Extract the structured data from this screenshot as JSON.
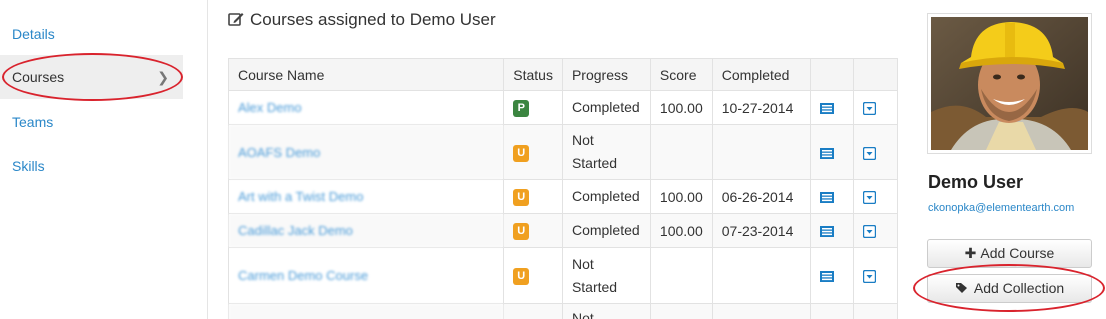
{
  "sidebar": {
    "items": [
      {
        "label": "Details"
      },
      {
        "label": "Courses"
      },
      {
        "label": "Teams"
      },
      {
        "label": "Skills"
      }
    ]
  },
  "main": {
    "title": "Courses assigned to Demo User",
    "columns": [
      "Course Name",
      "Status",
      "Progress",
      "Score",
      "Completed",
      "",
      ""
    ],
    "rows": [
      {
        "name": "Alex Demo",
        "status": "P",
        "progress": "Completed",
        "score": "100.00",
        "completed": "10-27-2014"
      },
      {
        "name": "AOAFS Demo",
        "status": "U",
        "progress": "Not\nStarted",
        "score": "",
        "completed": ""
      },
      {
        "name": "Art with a Twist Demo",
        "status": "U",
        "progress": "Completed",
        "score": "100.00",
        "completed": "06-26-2014"
      },
      {
        "name": "Cadillac Jack Demo",
        "status": "U",
        "progress": "Completed",
        "score": "100.00",
        "completed": "07-23-2014"
      },
      {
        "name": "Carmen Demo Course",
        "status": "U",
        "progress": "Not\nStarted",
        "score": "",
        "completed": ""
      },
      {
        "name": "",
        "status": "",
        "progress": "Not",
        "score": "",
        "completed": ""
      }
    ]
  },
  "profile": {
    "name": "Demo User",
    "email": "ckonopka@elementearth.com",
    "add_course_label": "Add Course",
    "add_collection_label": "Add Collection"
  },
  "colors": {
    "link": "#2a87c8",
    "passed_badge": "#3b8540",
    "unstarted_badge": "#f0a020",
    "annotation": "#d9232d"
  },
  "icons": [
    "chevron-right-icon",
    "edit-icon",
    "list-icon",
    "dropdown-icon",
    "plus-icon",
    "tags-icon"
  ]
}
